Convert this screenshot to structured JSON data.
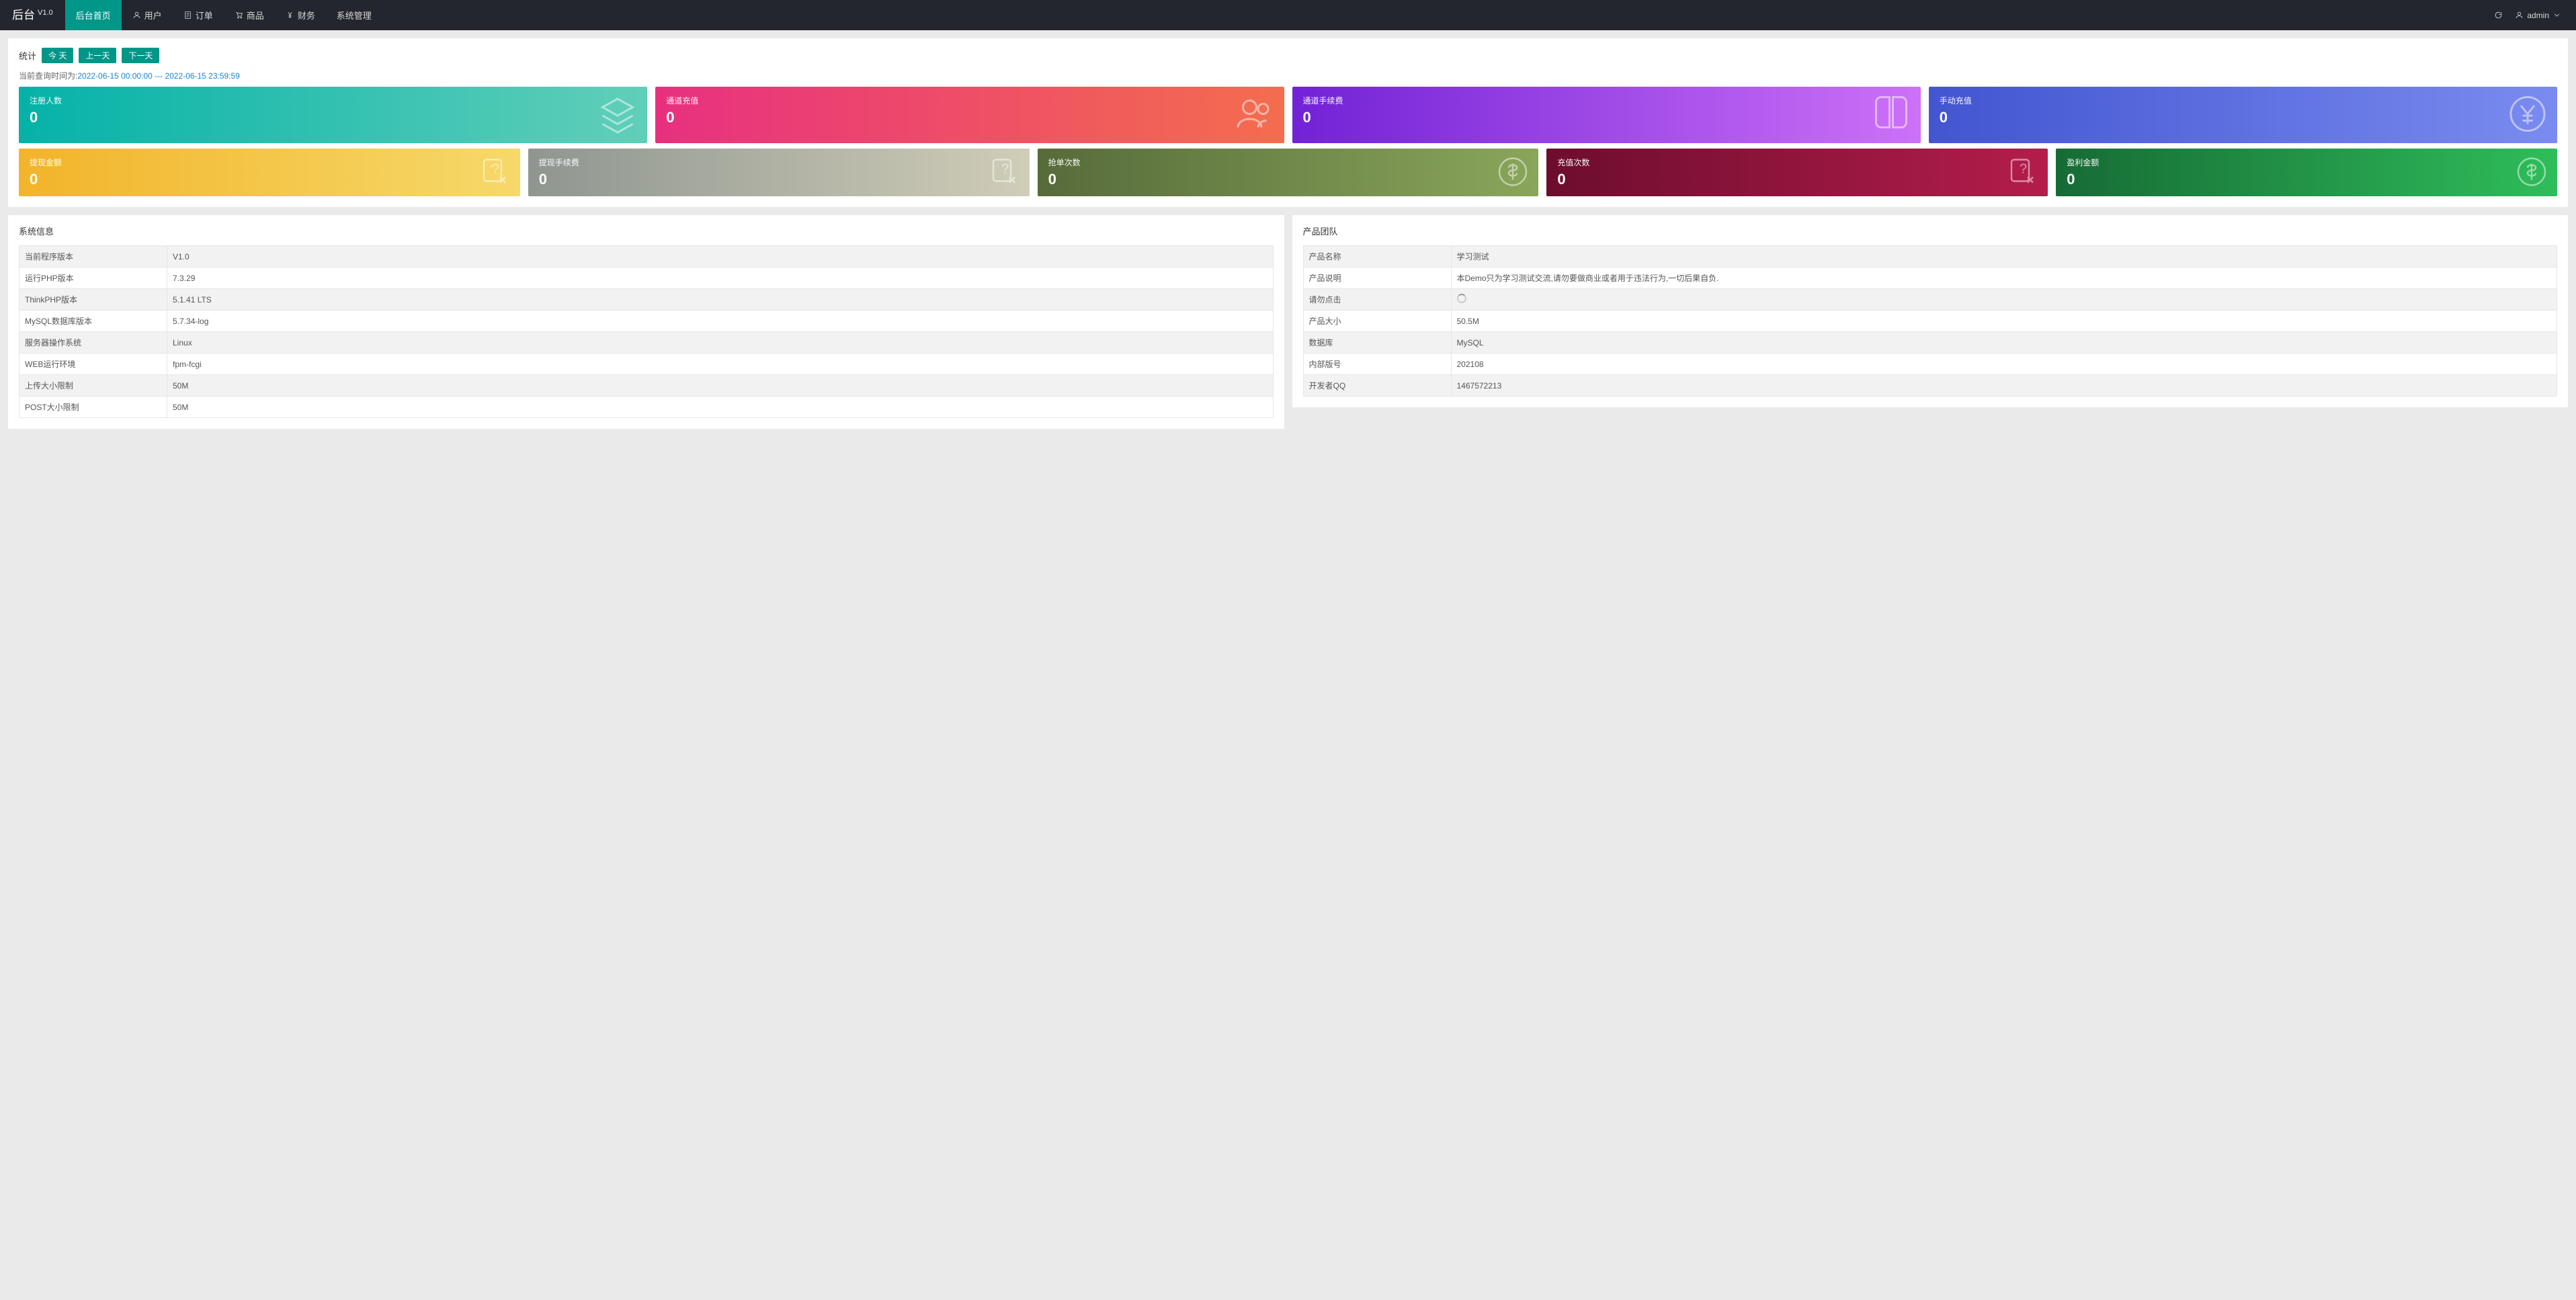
{
  "header": {
    "logo": "后台",
    "version": "V1.0",
    "nav": [
      {
        "label": "后台首页"
      },
      {
        "label": "用户"
      },
      {
        "label": "订单"
      },
      {
        "label": "商品"
      },
      {
        "label": "财务"
      },
      {
        "label": "系统管理"
      }
    ],
    "user": "admin"
  },
  "stats": {
    "label": "统计",
    "buttons": {
      "today": "今 天",
      "prev": "上一天",
      "next": "下一天"
    },
    "query_prefix": "当前查询时间为:",
    "query_time": "2022-06-15 00:00:00 --- 2022-06-15 23:59:59"
  },
  "tiles_row1": [
    {
      "title": "注册人数",
      "value": "0"
    },
    {
      "title": "通道充值",
      "value": "0"
    },
    {
      "title": "通道手续费",
      "value": "0"
    },
    {
      "title": "手动充值",
      "value": "0"
    }
  ],
  "tiles_row2": [
    {
      "title": "提现金额",
      "value": "0"
    },
    {
      "title": "提现手续费",
      "value": "0"
    },
    {
      "title": "抢单次数",
      "value": "0"
    },
    {
      "title": "充值次数",
      "value": "0"
    },
    {
      "title": "盈利金额",
      "value": "0"
    }
  ],
  "sysinfo": {
    "title": "系统信息",
    "rows": [
      {
        "k": "当前程序版本",
        "v": "V1.0"
      },
      {
        "k": "运行PHP版本",
        "v": "7.3.29"
      },
      {
        "k": "ThinkPHP版本",
        "v": "5.1.41 LTS"
      },
      {
        "k": "MySQL数据库版本",
        "v": "5.7.34-log"
      },
      {
        "k": "服务器操作系统",
        "v": "Linux"
      },
      {
        "k": "WEB运行环境",
        "v": "fpm-fcgi"
      },
      {
        "k": "上传大小限制",
        "v": "50M"
      },
      {
        "k": "POST大小限制",
        "v": "50M"
      }
    ]
  },
  "team": {
    "title": "产品团队",
    "rows": [
      {
        "k": "产品名称",
        "v": "学习测试"
      },
      {
        "k": "产品说明",
        "v": "本Demo只为学习测试交流,请勿要做商业或者用于违法行为,一切后果自负."
      },
      {
        "k": "请勿点击",
        "v": ""
      },
      {
        "k": "产品大小",
        "v": "50.5M"
      },
      {
        "k": "数据库",
        "v": "MySQL"
      },
      {
        "k": "内部版号",
        "v": "202108"
      },
      {
        "k": "开发者QQ",
        "v": "1467572213"
      }
    ]
  }
}
